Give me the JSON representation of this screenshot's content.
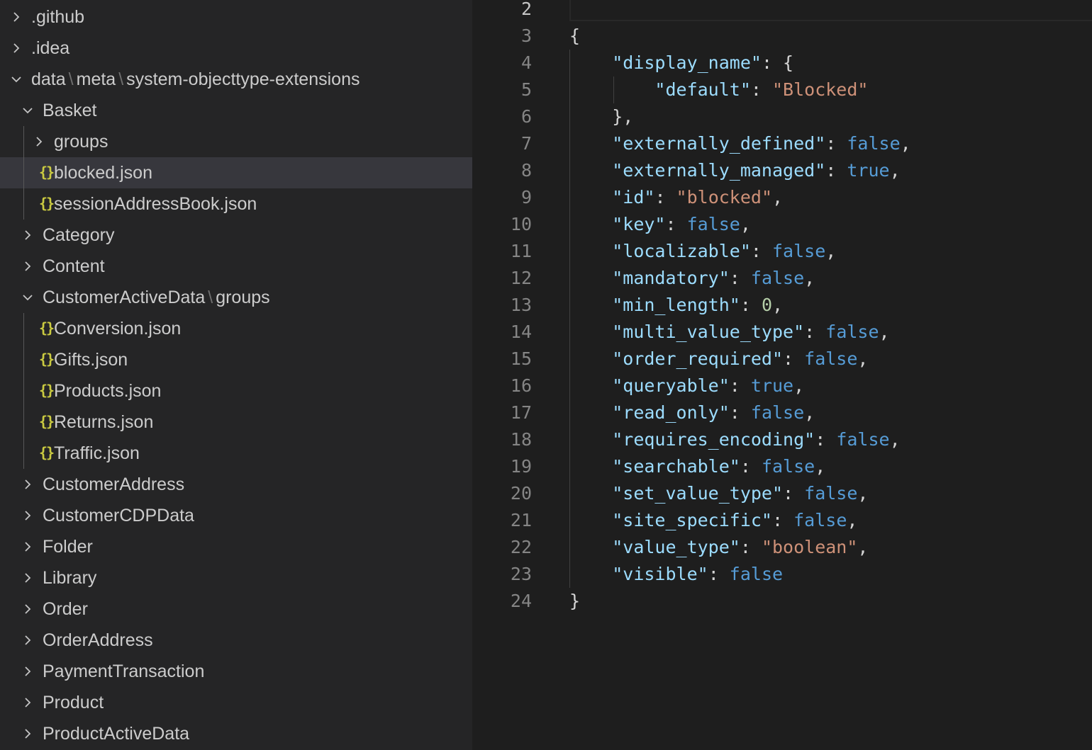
{
  "explorer": {
    "items": [
      {
        "kind": "folder",
        "state": "collapsed",
        "label": ".github"
      },
      {
        "kind": "folder",
        "state": "collapsed",
        "label": ".idea"
      },
      {
        "kind": "folder",
        "state": "expanded",
        "path": [
          "data",
          "meta",
          "system-objecttype-extensions"
        ]
      },
      {
        "kind": "folder",
        "state": "expanded",
        "label": "Basket"
      },
      {
        "kind": "folder",
        "state": "collapsed",
        "label": "groups"
      },
      {
        "kind": "file",
        "label": "blocked.json",
        "selected": true
      },
      {
        "kind": "file",
        "label": "sessionAddressBook.json"
      },
      {
        "kind": "folder",
        "state": "collapsed",
        "label": "Category"
      },
      {
        "kind": "folder",
        "state": "collapsed",
        "label": "Content"
      },
      {
        "kind": "folder",
        "state": "expanded",
        "path": [
          "CustomerActiveData",
          "groups"
        ]
      },
      {
        "kind": "file",
        "label": "Conversion.json"
      },
      {
        "kind": "file",
        "label": "Gifts.json"
      },
      {
        "kind": "file",
        "label": "Products.json"
      },
      {
        "kind": "file",
        "label": "Returns.json"
      },
      {
        "kind": "file",
        "label": "Traffic.json"
      },
      {
        "kind": "folder",
        "state": "collapsed",
        "label": "CustomerAddress"
      },
      {
        "kind": "folder",
        "state": "collapsed",
        "label": "CustomerCDPData"
      },
      {
        "kind": "folder",
        "state": "collapsed",
        "label": "Folder"
      },
      {
        "kind": "folder",
        "state": "collapsed",
        "label": "Library"
      },
      {
        "kind": "folder",
        "state": "collapsed",
        "label": "Order"
      },
      {
        "kind": "folder",
        "state": "collapsed",
        "label": "OrderAddress"
      },
      {
        "kind": "folder",
        "state": "collapsed",
        "label": "PaymentTransaction"
      },
      {
        "kind": "folder",
        "state": "collapsed",
        "label": "Product"
      },
      {
        "kind": "folder",
        "state": "collapsed",
        "label": "ProductActiveData"
      }
    ],
    "file_icon": "{}",
    "icon_names": {
      "collapsed": "chevron-right-icon",
      "expanded": "chevron-down-icon",
      "file": "json-file-icon"
    }
  },
  "editor": {
    "current_line": "2",
    "lines": [
      {
        "num": "2",
        "tokens": []
      },
      {
        "num": "3",
        "tokens": [
          {
            "t": "p",
            "v": "{"
          }
        ]
      },
      {
        "num": "4",
        "tokens": [
          {
            "t": "p",
            "v": "    "
          },
          {
            "t": "k",
            "v": "\"display_name\""
          },
          {
            "t": "p",
            "v": ": {"
          }
        ]
      },
      {
        "num": "5",
        "tokens": [
          {
            "t": "p",
            "v": "        "
          },
          {
            "t": "k",
            "v": "\"default\""
          },
          {
            "t": "p",
            "v": ": "
          },
          {
            "t": "s",
            "v": "\"Blocked\""
          }
        ]
      },
      {
        "num": "6",
        "tokens": [
          {
            "t": "p",
            "v": "    },"
          }
        ]
      },
      {
        "num": "7",
        "tokens": [
          {
            "t": "p",
            "v": "    "
          },
          {
            "t": "k",
            "v": "\"externally_defined\""
          },
          {
            "t": "p",
            "v": ": "
          },
          {
            "t": "b",
            "v": "false"
          },
          {
            "t": "p",
            "v": ","
          }
        ]
      },
      {
        "num": "8",
        "tokens": [
          {
            "t": "p",
            "v": "    "
          },
          {
            "t": "k",
            "v": "\"externally_managed\""
          },
          {
            "t": "p",
            "v": ": "
          },
          {
            "t": "b",
            "v": "true"
          },
          {
            "t": "p",
            "v": ","
          }
        ]
      },
      {
        "num": "9",
        "tokens": [
          {
            "t": "p",
            "v": "    "
          },
          {
            "t": "k",
            "v": "\"id\""
          },
          {
            "t": "p",
            "v": ": "
          },
          {
            "t": "s",
            "v": "\"blocked\""
          },
          {
            "t": "p",
            "v": ","
          }
        ]
      },
      {
        "num": "10",
        "tokens": [
          {
            "t": "p",
            "v": "    "
          },
          {
            "t": "k",
            "v": "\"key\""
          },
          {
            "t": "p",
            "v": ": "
          },
          {
            "t": "b",
            "v": "false"
          },
          {
            "t": "p",
            "v": ","
          }
        ]
      },
      {
        "num": "11",
        "tokens": [
          {
            "t": "p",
            "v": "    "
          },
          {
            "t": "k",
            "v": "\"localizable\""
          },
          {
            "t": "p",
            "v": ": "
          },
          {
            "t": "b",
            "v": "false"
          },
          {
            "t": "p",
            "v": ","
          }
        ]
      },
      {
        "num": "12",
        "tokens": [
          {
            "t": "p",
            "v": "    "
          },
          {
            "t": "k",
            "v": "\"mandatory\""
          },
          {
            "t": "p",
            "v": ": "
          },
          {
            "t": "b",
            "v": "false"
          },
          {
            "t": "p",
            "v": ","
          }
        ]
      },
      {
        "num": "13",
        "tokens": [
          {
            "t": "p",
            "v": "    "
          },
          {
            "t": "k",
            "v": "\"min_length\""
          },
          {
            "t": "p",
            "v": ": "
          },
          {
            "t": "n",
            "v": "0"
          },
          {
            "t": "p",
            "v": ","
          }
        ]
      },
      {
        "num": "14",
        "tokens": [
          {
            "t": "p",
            "v": "    "
          },
          {
            "t": "k",
            "v": "\"multi_value_type\""
          },
          {
            "t": "p",
            "v": ": "
          },
          {
            "t": "b",
            "v": "false"
          },
          {
            "t": "p",
            "v": ","
          }
        ]
      },
      {
        "num": "15",
        "tokens": [
          {
            "t": "p",
            "v": "    "
          },
          {
            "t": "k",
            "v": "\"order_required\""
          },
          {
            "t": "p",
            "v": ": "
          },
          {
            "t": "b",
            "v": "false"
          },
          {
            "t": "p",
            "v": ","
          }
        ]
      },
      {
        "num": "16",
        "tokens": [
          {
            "t": "p",
            "v": "    "
          },
          {
            "t": "k",
            "v": "\"queryable\""
          },
          {
            "t": "p",
            "v": ": "
          },
          {
            "t": "b",
            "v": "true"
          },
          {
            "t": "p",
            "v": ","
          }
        ]
      },
      {
        "num": "17",
        "tokens": [
          {
            "t": "p",
            "v": "    "
          },
          {
            "t": "k",
            "v": "\"read_only\""
          },
          {
            "t": "p",
            "v": ": "
          },
          {
            "t": "b",
            "v": "false"
          },
          {
            "t": "p",
            "v": ","
          }
        ]
      },
      {
        "num": "18",
        "tokens": [
          {
            "t": "p",
            "v": "    "
          },
          {
            "t": "k",
            "v": "\"requires_encoding\""
          },
          {
            "t": "p",
            "v": ": "
          },
          {
            "t": "b",
            "v": "false"
          },
          {
            "t": "p",
            "v": ","
          }
        ]
      },
      {
        "num": "19",
        "tokens": [
          {
            "t": "p",
            "v": "    "
          },
          {
            "t": "k",
            "v": "\"searchable\""
          },
          {
            "t": "p",
            "v": ": "
          },
          {
            "t": "b",
            "v": "false"
          },
          {
            "t": "p",
            "v": ","
          }
        ]
      },
      {
        "num": "20",
        "tokens": [
          {
            "t": "p",
            "v": "    "
          },
          {
            "t": "k",
            "v": "\"set_value_type\""
          },
          {
            "t": "p",
            "v": ": "
          },
          {
            "t": "b",
            "v": "false"
          },
          {
            "t": "p",
            "v": ","
          }
        ]
      },
      {
        "num": "21",
        "tokens": [
          {
            "t": "p",
            "v": "    "
          },
          {
            "t": "k",
            "v": "\"site_specific\""
          },
          {
            "t": "p",
            "v": ": "
          },
          {
            "t": "b",
            "v": "false"
          },
          {
            "t": "p",
            "v": ","
          }
        ]
      },
      {
        "num": "22",
        "tokens": [
          {
            "t": "p",
            "v": "    "
          },
          {
            "t": "k",
            "v": "\"value_type\""
          },
          {
            "t": "p",
            "v": ": "
          },
          {
            "t": "s",
            "v": "\"boolean\""
          },
          {
            "t": "p",
            "v": ","
          }
        ]
      },
      {
        "num": "23",
        "tokens": [
          {
            "t": "p",
            "v": "    "
          },
          {
            "t": "k",
            "v": "\"visible\""
          },
          {
            "t": "p",
            "v": ": "
          },
          {
            "t": "b",
            "v": "false"
          }
        ]
      },
      {
        "num": "24",
        "tokens": [
          {
            "t": "p",
            "v": "}"
          }
        ]
      }
    ]
  },
  "colors": {
    "sidebar_bg": "#252526",
    "editor_bg": "#1e1e1e",
    "selection_bg": "#37373d",
    "json_key": "#9cdcfe",
    "json_string": "#ce9178",
    "json_boolean": "#569cd6",
    "json_number": "#b5cea8",
    "json_icon": "#cbcb41"
  }
}
